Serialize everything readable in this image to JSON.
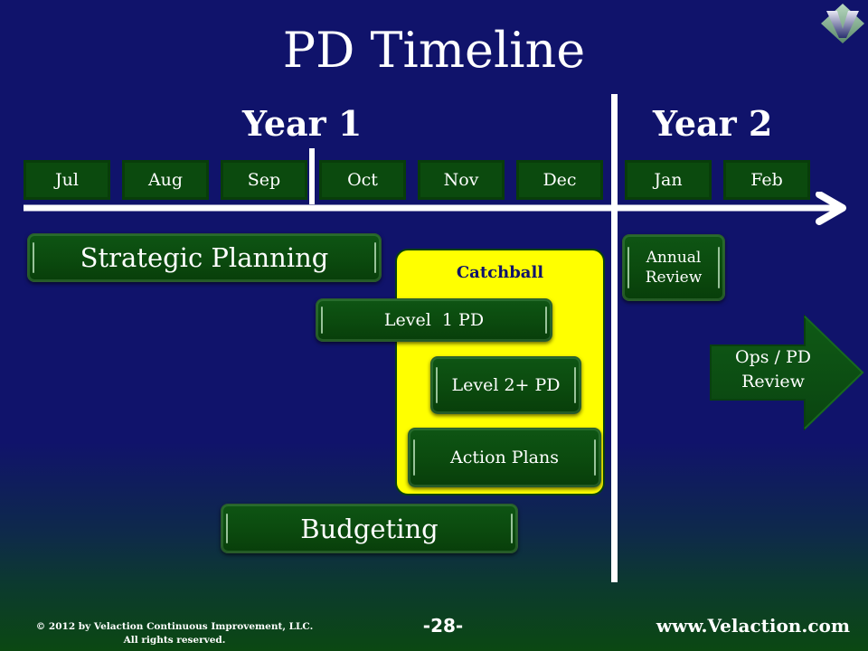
{
  "slide": {
    "title": "PD Timeline",
    "logo_icon": "velaction-v-diamond-logo",
    "years": [
      {
        "label": "Year 1"
      },
      {
        "label": "Year 2"
      }
    ],
    "months": [
      "Jul",
      "Aug",
      "Sep",
      "Oct",
      "Nov",
      "Dec",
      "Jan",
      "Feb"
    ],
    "catchball": {
      "label": "Catchball"
    },
    "activities": {
      "strategic_planning": "Strategic Planning",
      "level1_pd": "Level  1 PD",
      "level2_pd": "Level 2+ PD",
      "action_plans": "Action Plans",
      "budgeting": "Budgeting",
      "annual_review_line1": "Annual",
      "annual_review_line2": "Review",
      "ops_review_line1": "Ops / PD",
      "ops_review_line2": "Review"
    },
    "colors": {
      "background": "#10136b",
      "box_green": "#0b4a0e",
      "catchball_yellow": "#ffff00",
      "catchball_text": "#10136b"
    }
  },
  "footer": {
    "copyright_line1": "© 2012 by Velaction Continuous Improvement, LLC.",
    "copyright_line2": "All rights reserved.",
    "page_number": "-28-",
    "url": "www.Velaction.com"
  }
}
